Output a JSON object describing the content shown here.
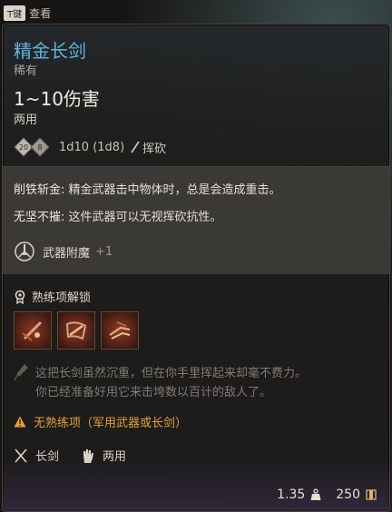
{
  "key_hint": {
    "key": "T键",
    "label": "查看"
  },
  "item": {
    "name": "精金长剑",
    "rarity": "稀有",
    "damage": "1~10伤害",
    "handedness": "两用"
  },
  "dice": {
    "die_1": "20",
    "die_2": "8",
    "formula": "1d10 (1d8)",
    "damage_type": "挥砍"
  },
  "properties": [
    {
      "name": "削铁斩金:",
      "text": "精金武器击中物体时，总是会造成重击。"
    },
    {
      "name": "无坚不摧:",
      "text": "这件武器可以无视挥砍抗性。"
    }
  ],
  "enchantment": {
    "label": "武器附魔",
    "bonus": "+1"
  },
  "proficiency": {
    "header": "熟练项解锁",
    "actions": [
      "action-1",
      "action-2",
      "action-3"
    ]
  },
  "flavor_text": [
    "这把长剑虽然沉重，但在你手里挥起来却毫不费力。",
    "你已经准备好用它来击垮数以百计的敌人了。"
  ],
  "warning": "无熟练项（军用武器或长剑）",
  "traits": [
    {
      "icon": "sword-icon",
      "label": "长剑"
    },
    {
      "icon": "hand-icon",
      "label": "两用"
    }
  ],
  "footer": {
    "weight": "1.35",
    "value": "250"
  },
  "colors": {
    "item_name": "#5fb6de",
    "warning": "#e3a13a",
    "panel_bg": "#1e1e1d",
    "props_bg": "#3a3935"
  }
}
